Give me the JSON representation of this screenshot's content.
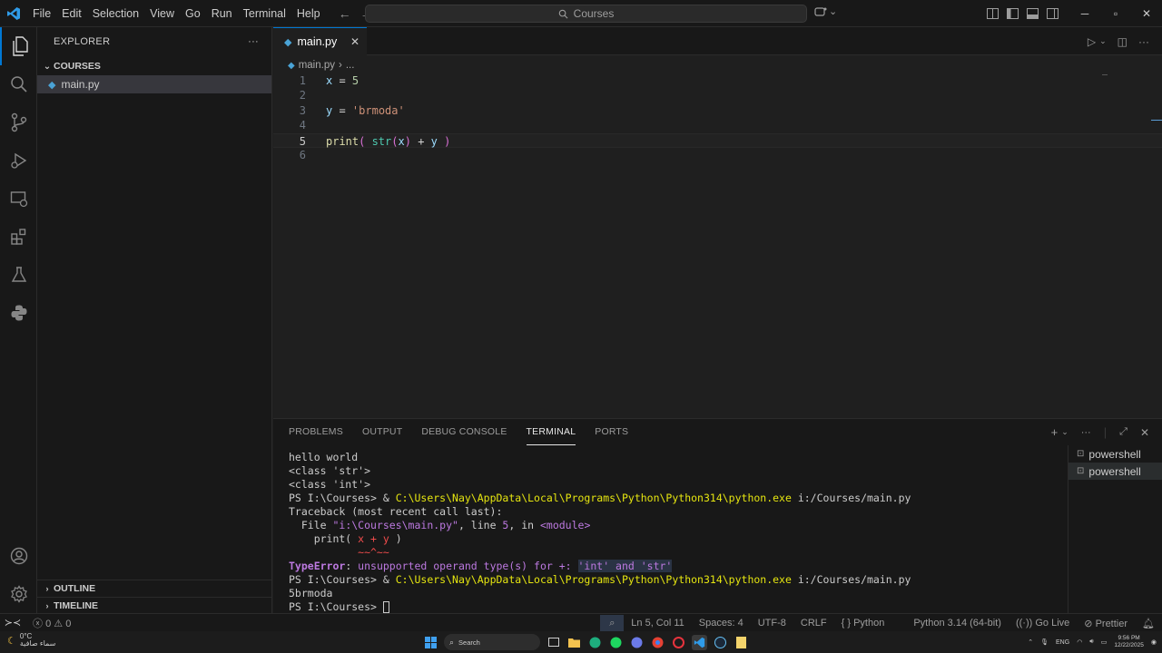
{
  "menu": [
    "File",
    "Edit",
    "Selection",
    "View",
    "Go",
    "Run",
    "Terminal",
    "Help"
  ],
  "command_center": {
    "label": "Courses"
  },
  "explorer": {
    "title": "EXPLORER",
    "folder": "COURSES",
    "files": [
      "main.py"
    ],
    "outline": "OUTLINE",
    "timeline": "TIMELINE"
  },
  "editor": {
    "tab_label": "main.py",
    "breadcrumb_file": "main.py",
    "breadcrumb_more": "...",
    "line_numbers": [
      "1",
      "2",
      "3",
      "4",
      "5",
      "6"
    ],
    "code": {
      "l1_var": "x",
      "l1_op": " = ",
      "l1_val": "5",
      "l3_var": "y",
      "l3_op": " = ",
      "l3_val": "'brmoda'",
      "l5_fn": "print",
      "l5_open": "( ",
      "l5_str": "str",
      "l5_p1": "(",
      "l5_x": "x",
      "l5_p2": ")",
      "l5_plus": " + ",
      "l5_y": "y",
      "l5_close": " )"
    }
  },
  "panel": {
    "tabs": [
      "PROBLEMS",
      "OUTPUT",
      "DEBUG CONSOLE",
      "TERMINAL",
      "PORTS"
    ],
    "active_tab": "TERMINAL",
    "terminals": [
      "powershell",
      "powershell"
    ],
    "lines": {
      "t1": "hello world",
      "t2": "<class 'str'>",
      "t3": "<class 'int'>",
      "t4_prompt": "PS I:\\Courses> ",
      "t4_amp": "& ",
      "t4_exe": "C:\\Users\\Nay\\AppData\\Local\\Programs\\Python\\Python314\\python.exe",
      "t4_arg": " i:/Courses/main.py",
      "t5": "Traceback (most recent call last):",
      "t6_a": "  File ",
      "t6_file": "\"i:\\Courses\\main.py\"",
      "t6_b": ", line ",
      "t6_line": "5",
      "t6_c": ", in ",
      "t6_mod": "<module>",
      "t7_a": "    print( ",
      "t7_b": "x + y",
      "t7_c": " )",
      "t8": "           ~~^~~",
      "t9_err": "TypeError",
      "t9_a": ": ",
      "t9_msg": "unsupported operand type(s) for +: ",
      "t9_hl": "'int' and 'str'",
      "t10_prompt": "PS I:\\Courses> ",
      "t10_amp": "& ",
      "t10_exe": "C:\\Users\\Nay\\AppData\\Local\\Programs\\Python\\Python314\\python.exe",
      "t10_arg": " i:/Courses/main.py",
      "t11": "5brmoda",
      "t12_prompt": "PS I:\\Courses> "
    }
  },
  "statusbar": {
    "errors": "0",
    "warnings": "0",
    "position": "Ln 5, Col 11",
    "spaces": "Spaces: 4",
    "encoding": "UTF-8",
    "eol": "CRLF",
    "language": "Python",
    "interpreter": "Python 3.14 (64-bit)",
    "golive": "Go Live",
    "prettier": "Prettier"
  },
  "taskbar": {
    "weather_temp": "0°C",
    "weather_desc": "سماء صافية",
    "search": "Search",
    "lang": "ENG",
    "time": "9:56 PM",
    "date": "12/22/2025"
  },
  "colors": {
    "accent": "#0078d4",
    "background": "#1f1f1f",
    "sidebar": "#181818"
  }
}
